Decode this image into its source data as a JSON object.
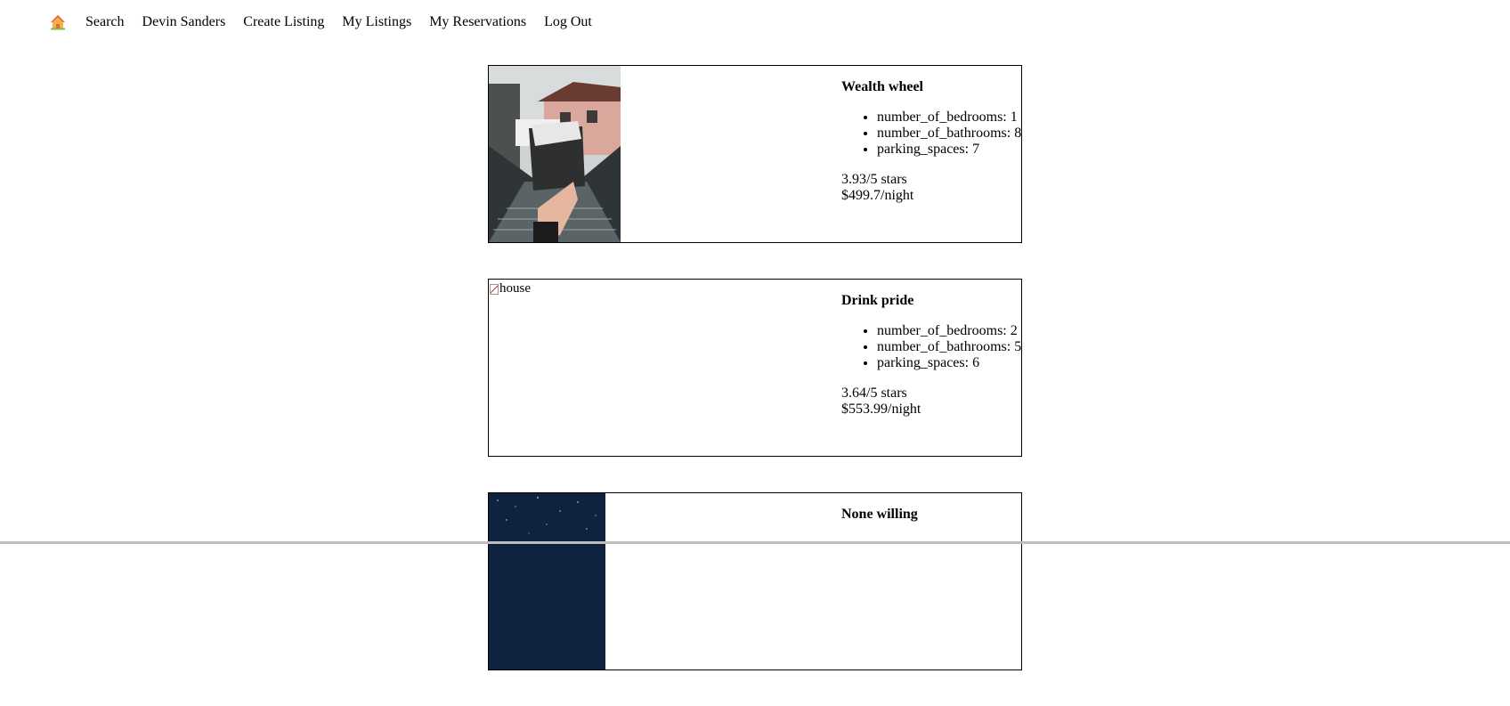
{
  "nav": {
    "home_icon": "home-icon",
    "items": [
      "Search",
      "Devin Sanders",
      "Create Listing",
      "My Listings",
      "My Reservations",
      "Log Out"
    ]
  },
  "listings": [
    {
      "title": "Wealth wheel",
      "features": [
        "number_of_bedrooms: 1",
        "number_of_bathrooms: 8",
        "parking_spaces: 7"
      ],
      "rating": "3.93/5 stars",
      "price": "$499.7/night",
      "image": "photo"
    },
    {
      "title": "Drink pride",
      "features": [
        "number_of_bedrooms: 2",
        "number_of_bathrooms: 5",
        "parking_spaces: 6"
      ],
      "rating": "3.64/5 stars",
      "price": "$553.99/night",
      "image_alt": "house"
    },
    {
      "title": "None willing",
      "image": "photo"
    }
  ],
  "colors": {
    "home_roof": "#e8643c",
    "home_body": "#f4b04a",
    "home_base": "#7fbf3f"
  }
}
